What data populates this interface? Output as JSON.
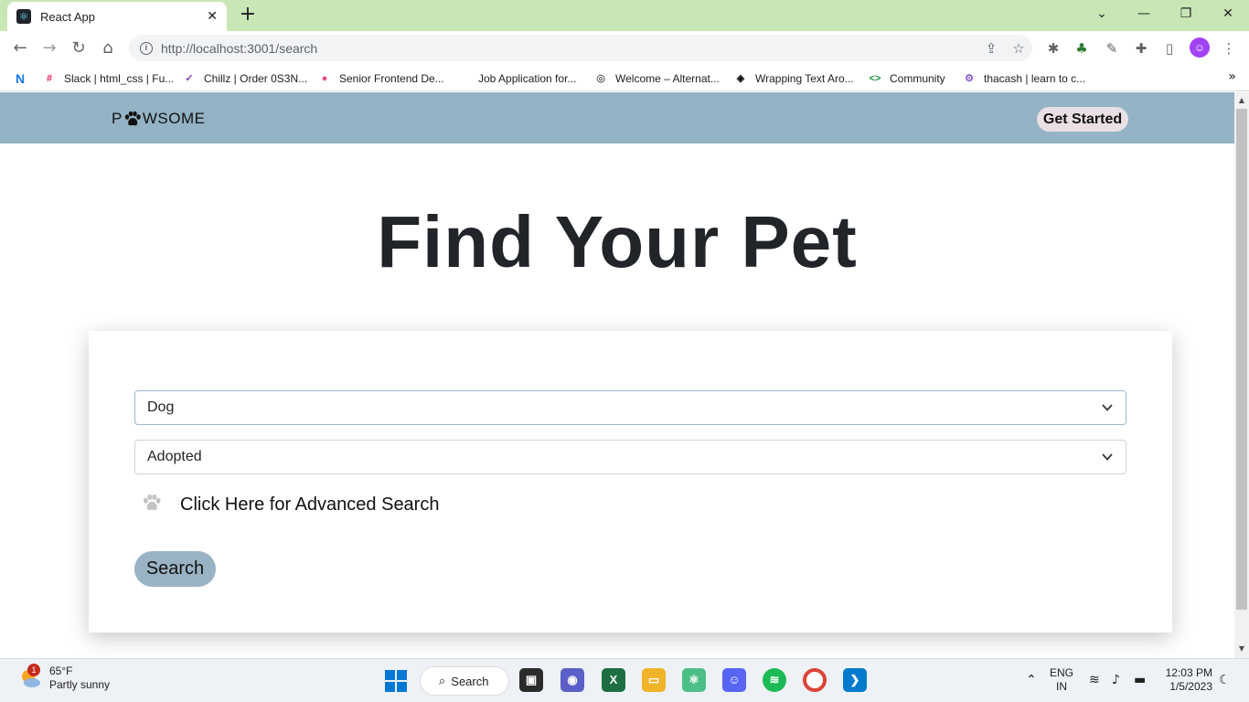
{
  "browser": {
    "tab_title": "React App",
    "tab_close": "✕",
    "new_tab": "+",
    "window_controls": {
      "dropdown": "⌄",
      "minimize": "—",
      "restore": "❐",
      "close": "✕"
    },
    "nav": {
      "back": "←",
      "forward": "→",
      "reload": "↻",
      "home": "⌂"
    },
    "url": "http://localhost:3001/search",
    "bookmarks": [
      {
        "label": "Slack | html_css | Fu...",
        "icon": "slack-icon",
        "color": "#e01e5a"
      },
      {
        "label": "Chillz | Order 0S3N...",
        "icon": "chillz-icon",
        "color": "#7b3fa0"
      },
      {
        "label": "Senior Frontend De...",
        "icon": "dribbble-icon",
        "color": "#ea4c89"
      },
      {
        "label": "Job Application for...",
        "icon": "blank-icon",
        "color": "#ffffff"
      },
      {
        "label": "Welcome – Alternat...",
        "icon": "globe-icon",
        "color": "#5f6368"
      },
      {
        "label": "Wrapping Text Aro...",
        "icon": "codepen-icon",
        "color": "#111111"
      },
      {
        "label": "Community",
        "icon": "code-icon",
        "color": "#1b8f3a"
      },
      {
        "label": "thacash | learn to c...",
        "icon": "thacash-icon",
        "color": "#8a5cc7"
      }
    ],
    "bookmark_first_icon": "N"
  },
  "app": {
    "brand": {
      "left": "P",
      "right": "WSOME"
    },
    "get_started": "Get Started",
    "hero_title": "Find Your Pet",
    "animal_select": "Dog",
    "status_select": "Adopted",
    "advanced_search": "Click Here for Advanced Search",
    "search_button": "Search",
    "accent_color": "#94b3c5"
  },
  "taskbar": {
    "weather_badge": "1",
    "temperature": "65°F",
    "condition": "Partly sunny",
    "search_label": "Search",
    "language": "ENG",
    "region": "IN",
    "time": "12:03 PM",
    "date": "1/5/2023"
  }
}
